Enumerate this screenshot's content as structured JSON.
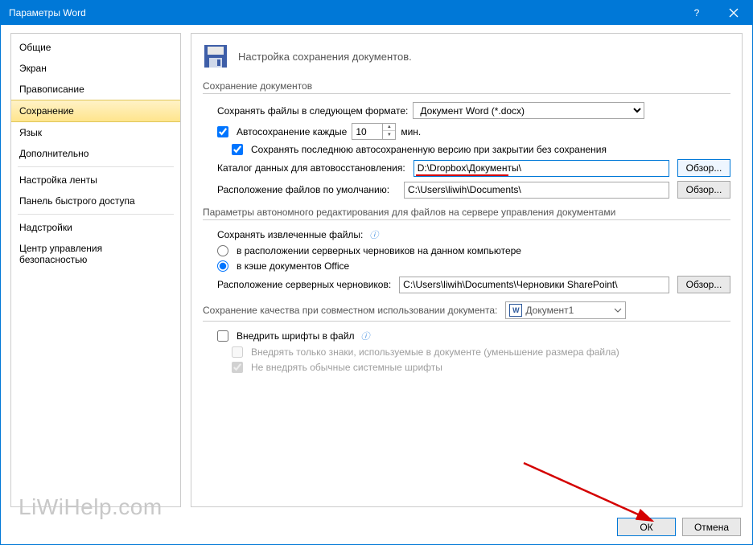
{
  "titlebar": {
    "title": "Параметры Word"
  },
  "sidebar": {
    "items": [
      "Общие",
      "Экран",
      "Правописание",
      "Сохранение",
      "Язык",
      "Дополнительно",
      "Настройка ленты",
      "Панель быстрого доступа",
      "Надстройки",
      "Центр управления безопасностью"
    ],
    "selected_index": 3
  },
  "header": {
    "text": "Настройка сохранения документов."
  },
  "save_section": {
    "title": "Сохранение документов",
    "format_label": "Сохранять файлы в следующем формате:",
    "format_value": "Документ Word (*.docx)",
    "autosave_label": "Автосохранение каждые",
    "autosave_value": "10",
    "autosave_unit": "мин.",
    "keep_last_label": "Сохранять последнюю автосохраненную версию при закрытии без сохранения",
    "autorecover_label": "Каталог данных для автовосстановления:",
    "autorecover_path": "D:\\Dropbox\\Документы\\",
    "default_loc_label": "Расположение файлов по умолчанию:",
    "default_loc_path": "C:\\Users\\liwih\\Documents\\",
    "browse": "Обзор..."
  },
  "offline_section": {
    "title": "Параметры автономного редактирования для файлов на сервере управления документами",
    "save_checked_label": "Сохранять извлеченные файлы:",
    "radio1": "в расположении серверных черновиков на данном компьютере",
    "radio2": "в кэше документов Office",
    "drafts_label": "Расположение серверных черновиков:",
    "drafts_path": "C:\\Users\\liwih\\Documents\\Черновики SharePoint\\",
    "browse": "Обзор..."
  },
  "quality_section": {
    "title": "Сохранение качества при совместном использовании документа:",
    "doc_name": "Документ1",
    "embed_fonts": "Внедрить шрифты в файл",
    "embed_subset": "Внедрять только знаки, используемые в документе (уменьшение размера файла)",
    "skip_system": "Не внедрять обычные системные шрифты"
  },
  "footer": {
    "ok": "ОК",
    "cancel": "Отмена"
  },
  "watermark": "LiWiHelp.com"
}
